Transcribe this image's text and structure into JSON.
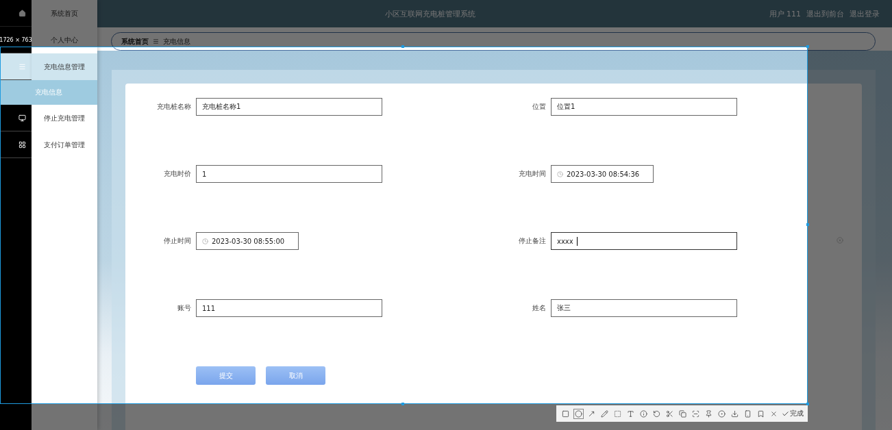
{
  "header": {
    "title": "小区互联网充电桩管理系统",
    "links": [
      {
        "label": "用户 111"
      },
      {
        "label": "退出到前台"
      },
      {
        "label": "退出登录"
      }
    ]
  },
  "sidebar": {
    "items": [
      {
        "label": "系统首页",
        "selected": false,
        "expanded": false
      },
      {
        "label": "个人中心",
        "selected": false,
        "expanded": false
      },
      {
        "label": "充电信息管理",
        "selected": false,
        "expanded": true,
        "children": [
          {
            "label": "充电信息",
            "selected": true
          }
        ]
      },
      {
        "label": "停止充电管理",
        "selected": false,
        "expanded": false
      },
      {
        "label": "支付订单管理",
        "selected": false,
        "expanded": false
      }
    ]
  },
  "breadcrumb": [
    "系统首页",
    "充电信息"
  ],
  "form": {
    "fields": [
      {
        "label": "充电桩名称",
        "kind": "text",
        "value": "充电桩名称1",
        "focused": false
      },
      {
        "label": "位置",
        "kind": "text",
        "value": "位置1",
        "focused": false
      },
      {
        "label": "充电时价",
        "kind": "text",
        "value": "1",
        "focused": false
      },
      {
        "label": "充电时间",
        "kind": "date",
        "value": "2023-03-30 08:54:36",
        "focused": false
      },
      {
        "label": "停止时间",
        "kind": "date",
        "value": "2023-03-30 08:55:00",
        "focused": false
      },
      {
        "label": "停止备注",
        "kind": "text",
        "value": "xxxx",
        "focused": true
      },
      {
        "label": "账号",
        "kind": "text",
        "value": "111",
        "focused": false
      },
      {
        "label": "姓名",
        "kind": "text",
        "value": "张三",
        "focused": false
      }
    ],
    "buttons": [
      "提交",
      "取消"
    ]
  },
  "capture": {
    "size_label": "1726 × 763",
    "tools": [
      {
        "kind": "rect",
        "selected": false
      },
      {
        "kind": "ellipse",
        "selected": true
      },
      {
        "kind": "arrow",
        "selected": false
      },
      {
        "kind": "pen",
        "selected": false
      },
      {
        "kind": "mosaic",
        "selected": false
      },
      {
        "kind": "text",
        "selected": false
      },
      {
        "kind": "number",
        "selected": false
      },
      {
        "kind": "undo",
        "selected": false
      },
      {
        "kind": "cut",
        "selected": false
      },
      {
        "kind": "copy",
        "selected": false
      },
      {
        "kind": "scan",
        "selected": false
      },
      {
        "kind": "pin",
        "selected": false
      },
      {
        "kind": "record",
        "selected": false
      },
      {
        "kind": "save",
        "selected": false
      },
      {
        "kind": "phone",
        "selected": false
      },
      {
        "kind": "bookmark",
        "selected": false
      },
      {
        "kind": "close",
        "selected": false
      }
    ],
    "done_label": "完成"
  }
}
